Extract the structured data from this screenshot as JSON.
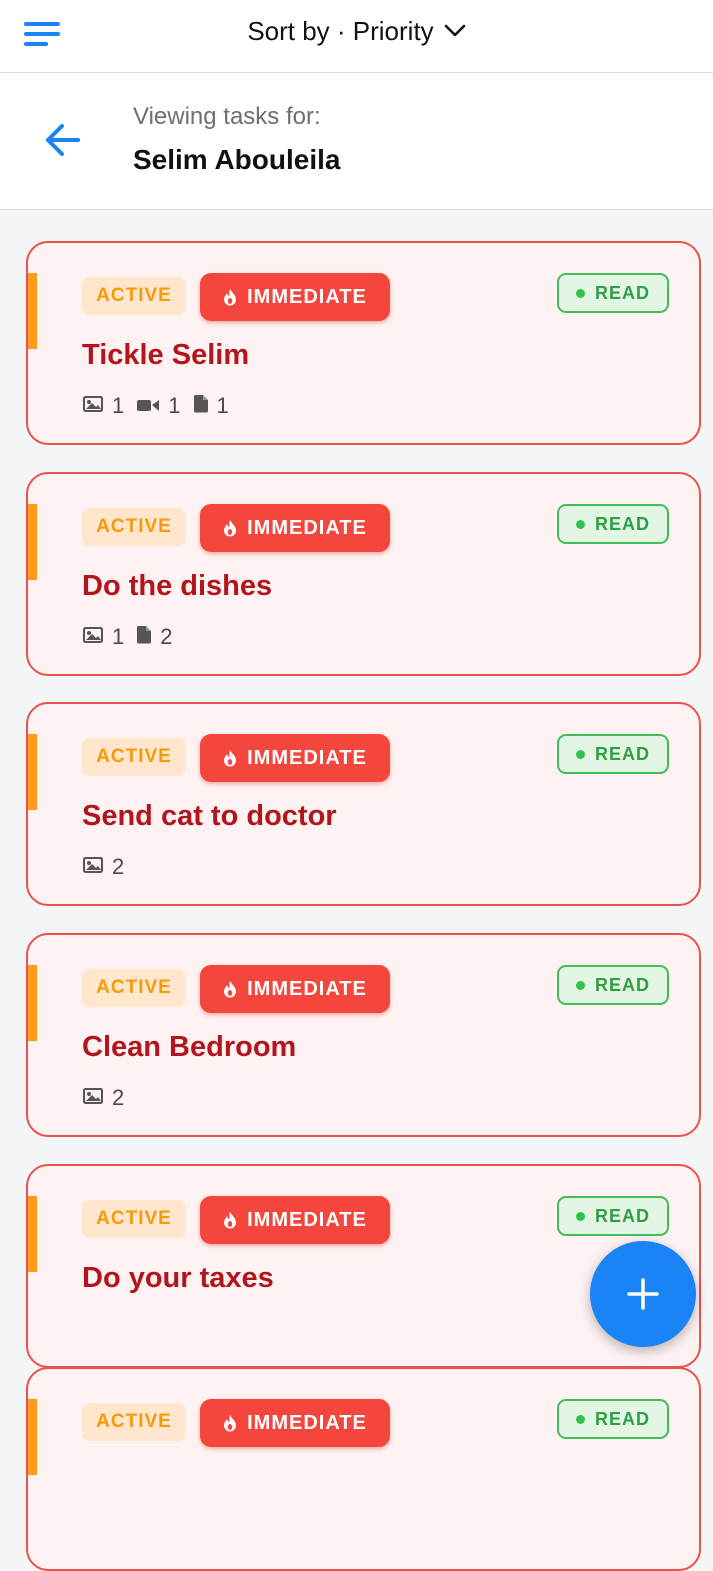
{
  "topbar": {
    "sort_label": "Sort by · Priority"
  },
  "header": {
    "viewing_label": "Viewing tasks for:",
    "name": "Selim Abouleila"
  },
  "colors": {
    "accent": "#1a83f5",
    "card_border": "#e9514b",
    "immediate_bg": "#f4463d",
    "active_text": "#f79a0a",
    "read_green": "#2f9e45",
    "title_red": "#b3151d",
    "stripe_orange": "#ff9b1a"
  },
  "tasks": [
    {
      "status": "ACTIVE",
      "priority": "IMMEDIATE",
      "read": "READ",
      "title": "Tickle Selim",
      "attachments": {
        "images": "1",
        "videos": "1",
        "files": "1"
      }
    },
    {
      "status": "ACTIVE",
      "priority": "IMMEDIATE",
      "read": "READ",
      "title": "Do the dishes",
      "attachments": {
        "images": "1",
        "files": "2"
      }
    },
    {
      "status": "ACTIVE",
      "priority": "IMMEDIATE",
      "read": "READ",
      "title": "Send cat to doctor",
      "attachments": {
        "images": "2"
      }
    },
    {
      "status": "ACTIVE",
      "priority": "IMMEDIATE",
      "read": "READ",
      "title": "Clean Bedroom",
      "attachments": {
        "images": "2"
      }
    },
    {
      "status": "ACTIVE",
      "priority": "IMMEDIATE",
      "read": "READ",
      "title": "Do your taxes",
      "attachments": {}
    },
    {
      "status": "ACTIVE",
      "priority": "IMMEDIATE",
      "read": "READ",
      "title": "",
      "attachments": {}
    }
  ],
  "icons": {
    "menu": "menu-icon",
    "back": "arrow-left-icon",
    "chevron": "chevron-down-icon",
    "fire": "flame-icon",
    "image": "image-icon",
    "video": "video-icon",
    "file": "file-icon",
    "add": "plus-icon"
  }
}
